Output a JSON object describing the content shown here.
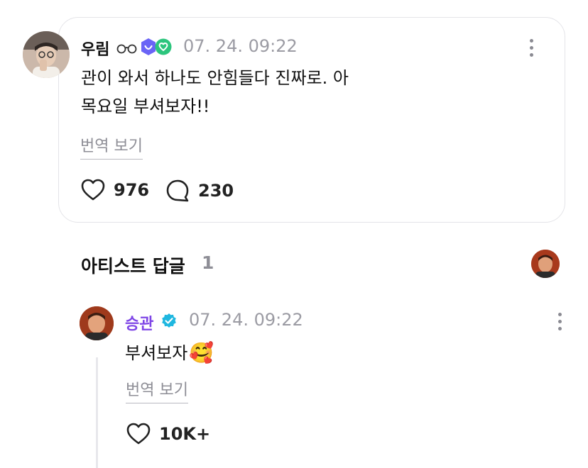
{
  "post": {
    "author": "우림",
    "time": "07. 24. 09:22",
    "text": "관이 와서 하나도 안힘들다 진짜로. 아\n목요일 부셔보자!!",
    "translate_label": "번역 보기",
    "likes": "976",
    "comments": "230"
  },
  "section": {
    "title": "아티스트 답글",
    "count": "1"
  },
  "reply": {
    "author": "승관",
    "time": "07. 24. 09:22",
    "text": "부셔보자",
    "emoji": "🥰",
    "translate_label": "번역 보기",
    "likes": "10K+"
  },
  "colors": {
    "artist_name": "#7e45e6",
    "verified_badge": "#1fb7e0",
    "badge_purple": "#6a64f6",
    "badge_green": "#2cc57d",
    "muted_text": "#9b9ba3"
  },
  "icons": [
    "more-vertical-icon",
    "heart-icon",
    "comment-icon",
    "verified-icon",
    "membership-badge-icon",
    "glasses-icon"
  ]
}
